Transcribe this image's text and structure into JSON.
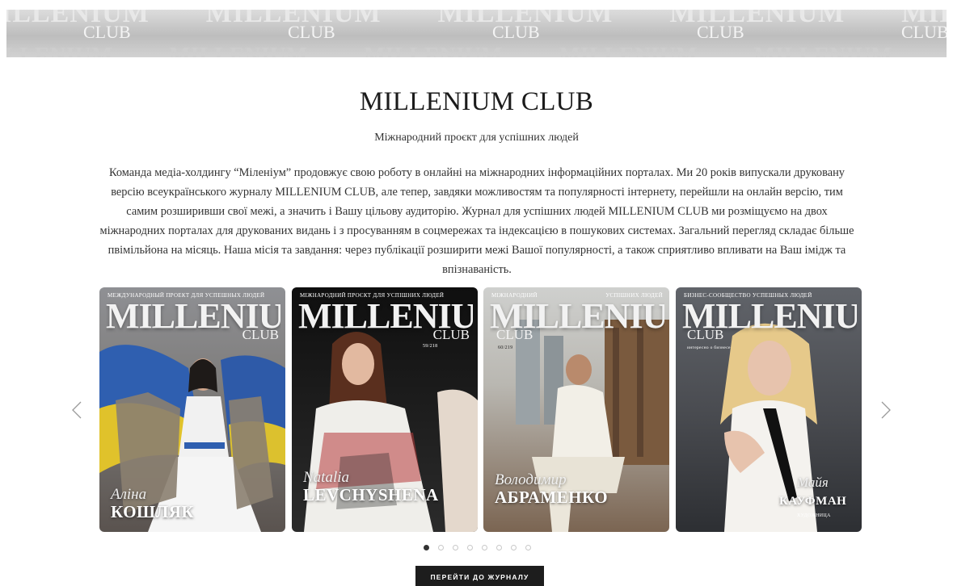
{
  "banner": {
    "repeat_word": "MILLENIUM",
    "repeat_sub": "CLUB"
  },
  "intro": {
    "title": "MILLENIUM CLUB",
    "subtitle": "Міжнародний проєкт для успішних людей",
    "description": "Команда медіа-холдингу “Міленіум” продовжує свою роботу в онлайні на міжнародних інформаційних порталах. Ми 20 років випускали друковану версію всеукраїнського журналу MILLENIUM CLUB, але тепер, завдяки можливостям та популярності інтернету, перейшли на онлайн версію, тим самим розширивши свої межі, а значить і Вашу цільову аудиторію. Журнал для успішних людей MILLENIUM CLUB ми розміщуємо на двох міжнародних порталах для друкованих видань і з просуванням в соцмережах та індексацією в пошукових системах. Загальний перегляд складає більше пвімільйона  на місяць. Наша місія та завдання: через публікації розширити межі Вашої популярності, а також сприятливо впливати на Ваш імідж та впізнаваність."
  },
  "carousel": {
    "prev_icon": "chevron-left-icon",
    "next_icon": "chevron-right-icon",
    "covers": [
      {
        "topline": "МЕЖДУНАРОДНЫЙ ПРОЕКТ ДЛЯ УСПЕШНЫХ ЛЮДЕЙ",
        "masthead": "MILLENIUM",
        "club": "CLUB",
        "first_name": "Аліна",
        "last_name": "КОШЛЯК",
        "bg_top": "#8e8f92",
        "bg_bottom": "#5b5350"
      },
      {
        "topline": "МІЖНАРОДНИЙ ПРОЄКТ ДЛЯ УСПІШНИХ ЛЮДЕЙ",
        "masthead": "MILLENIUM",
        "club": "CLUB",
        "issue": "59/218",
        "first_name": "Natalia",
        "last_name": "LEVCHYSHENA",
        "bg_top": "#111111",
        "bg_bottom": "#2a2a2a"
      },
      {
        "topline_left": "МІЖНАРОДНИЙ",
        "topline_right": "УСПІШНИХ ЛЮДЕЙ",
        "masthead": "MILLENIUM",
        "club": "CLUB",
        "issue": "60/219",
        "first_name": "Володимир",
        "last_name": "АБРАМЕНКО",
        "bg_top": "#c9c9c6",
        "bg_bottom": "#6e5a47"
      },
      {
        "topline": "БИЗНЕС-СООБЩЕСТВО УСПЕШНЫХ ЛЮДЕЙ",
        "masthead": "MILLENIUM",
        "club": "CLUB",
        "tagline": "интересно о бизнесе",
        "first_name": "Майя",
        "last_name": "КАУФМАН",
        "role": "ХУДОЖНИЦА",
        "bg_top": "#5b5e63",
        "bg_bottom": "#2e3034"
      }
    ],
    "dots_total": 8,
    "active_dot": 0
  },
  "cta": {
    "label": "ПЕРЕЙТИ ДО ЖУРНАЛУ"
  }
}
